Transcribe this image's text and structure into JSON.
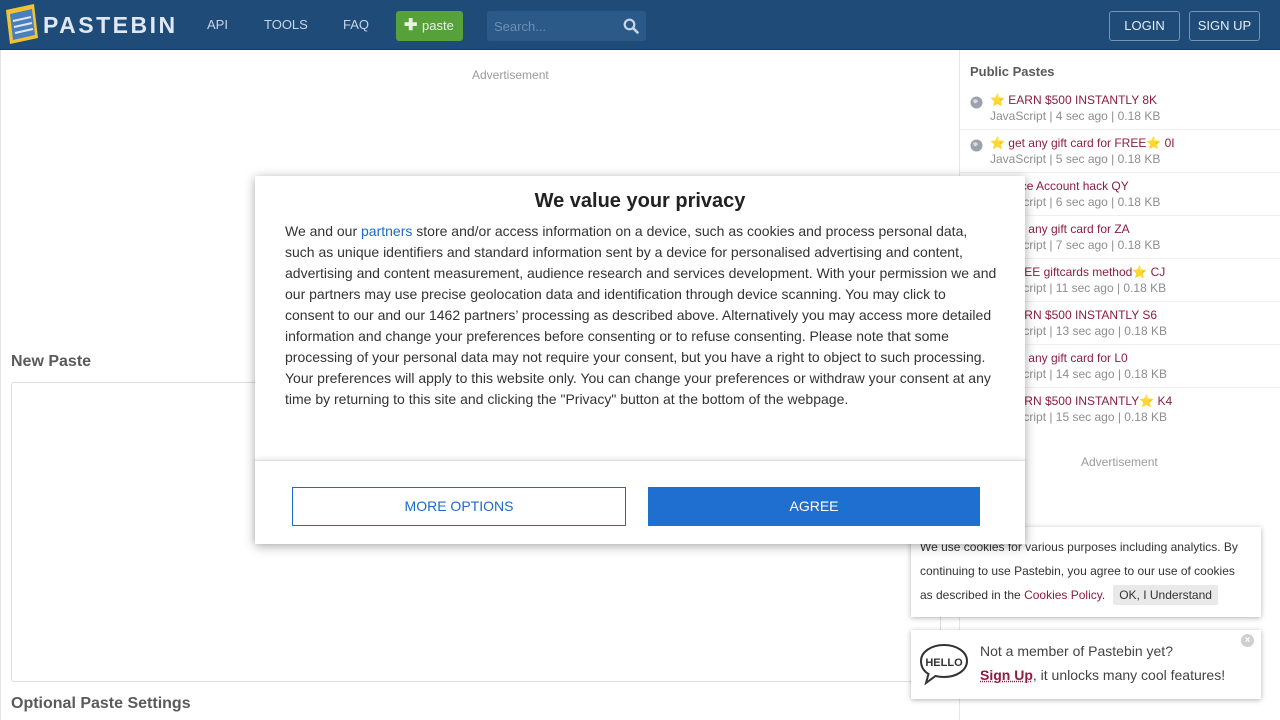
{
  "header": {
    "brand": "PASTEBIN",
    "nav": [
      "API",
      "TOOLS",
      "FAQ"
    ],
    "paste_button": "paste",
    "search_placeholder": "Search...",
    "login": "LOGIN",
    "signup": "SIGN UP"
  },
  "main": {
    "ad_label": "Advertisement",
    "new_paste_title": "New Paste",
    "optional_settings_title": "Optional Paste Settings"
  },
  "sidebar": {
    "title": "Public Pastes",
    "items": [
      {
        "title": "⭐ EARN $500 INSTANTLY 8K",
        "meta": "JavaScript | 4 sec ago | 0.18 KB"
      },
      {
        "title": "⭐ get any gift card for FREE⭐ 0I",
        "meta": "JavaScript | 5 sec ago | 0.18 KB"
      },
      {
        "title": "Binance Account hack QY",
        "meta": "JavaScript | 6 sec ago | 0.18 KB"
      },
      {
        "title": "⭐ get any gift card for ZA",
        "meta": "JavaScript | 7 sec ago | 0.18 KB"
      },
      {
        "title": "⭐ FREE giftcards method⭐ CJ",
        "meta": "JavaScript | 11 sec ago | 0.18 KB"
      },
      {
        "title": "⭐ EARN $500 INSTANTLY S6",
        "meta": "JavaScript | 13 sec ago | 0.18 KB"
      },
      {
        "title": "⭐ get any gift card for L0",
        "meta": "JavaScript | 14 sec ago | 0.18 KB"
      },
      {
        "title": "⭐ EARN $500 INSTANTLY⭐ K4",
        "meta": "JavaScript | 15 sec ago | 0.18 KB"
      }
    ],
    "ad_label": "Advertisement"
  },
  "consent": {
    "title": "We value your privacy",
    "body_prefix": "We and our ",
    "partners_link": "partners",
    "body_suffix": " store and/or access information on a device, such as cookies and process personal data, such as unique identifiers and standard information sent by a device for personalised advertising and content, advertising and content measurement, audience research and services development. With your permission we and our partners may use precise geolocation data and identification through device scanning. You may click to consent to our and our 1462 partners’ processing as described above. Alternatively you may access more detailed information and change your preferences before consenting or to refuse consenting. Please note that some processing of your personal data may not require your consent, but you have a right to object to such processing. Your preferences will apply to this website only. You can change your preferences or withdraw your consent at any time by returning to this site and clicking the \"Privacy\" button at the bottom of the webpage.",
    "more_options": "MORE OPTIONS",
    "agree": "AGREE"
  },
  "cookie_notice": {
    "text": "We use cookies for various purposes including analytics. By continuing to use Pastebin, you agree to our use of cookies as described in the ",
    "policy_link": "Cookies Policy",
    "period": ".",
    "ok": "OK, I Understand"
  },
  "hello": {
    "line1": "Not a member of Pastebin yet?",
    "signup": "Sign Up",
    "line2_suffix": ", it unlocks many cool features!"
  },
  "colors": {
    "header_bg": "#1e4b78",
    "paste_green": "#57a13b",
    "link_maroon": "#8c1d40",
    "agree_blue": "#1f6fd1"
  }
}
